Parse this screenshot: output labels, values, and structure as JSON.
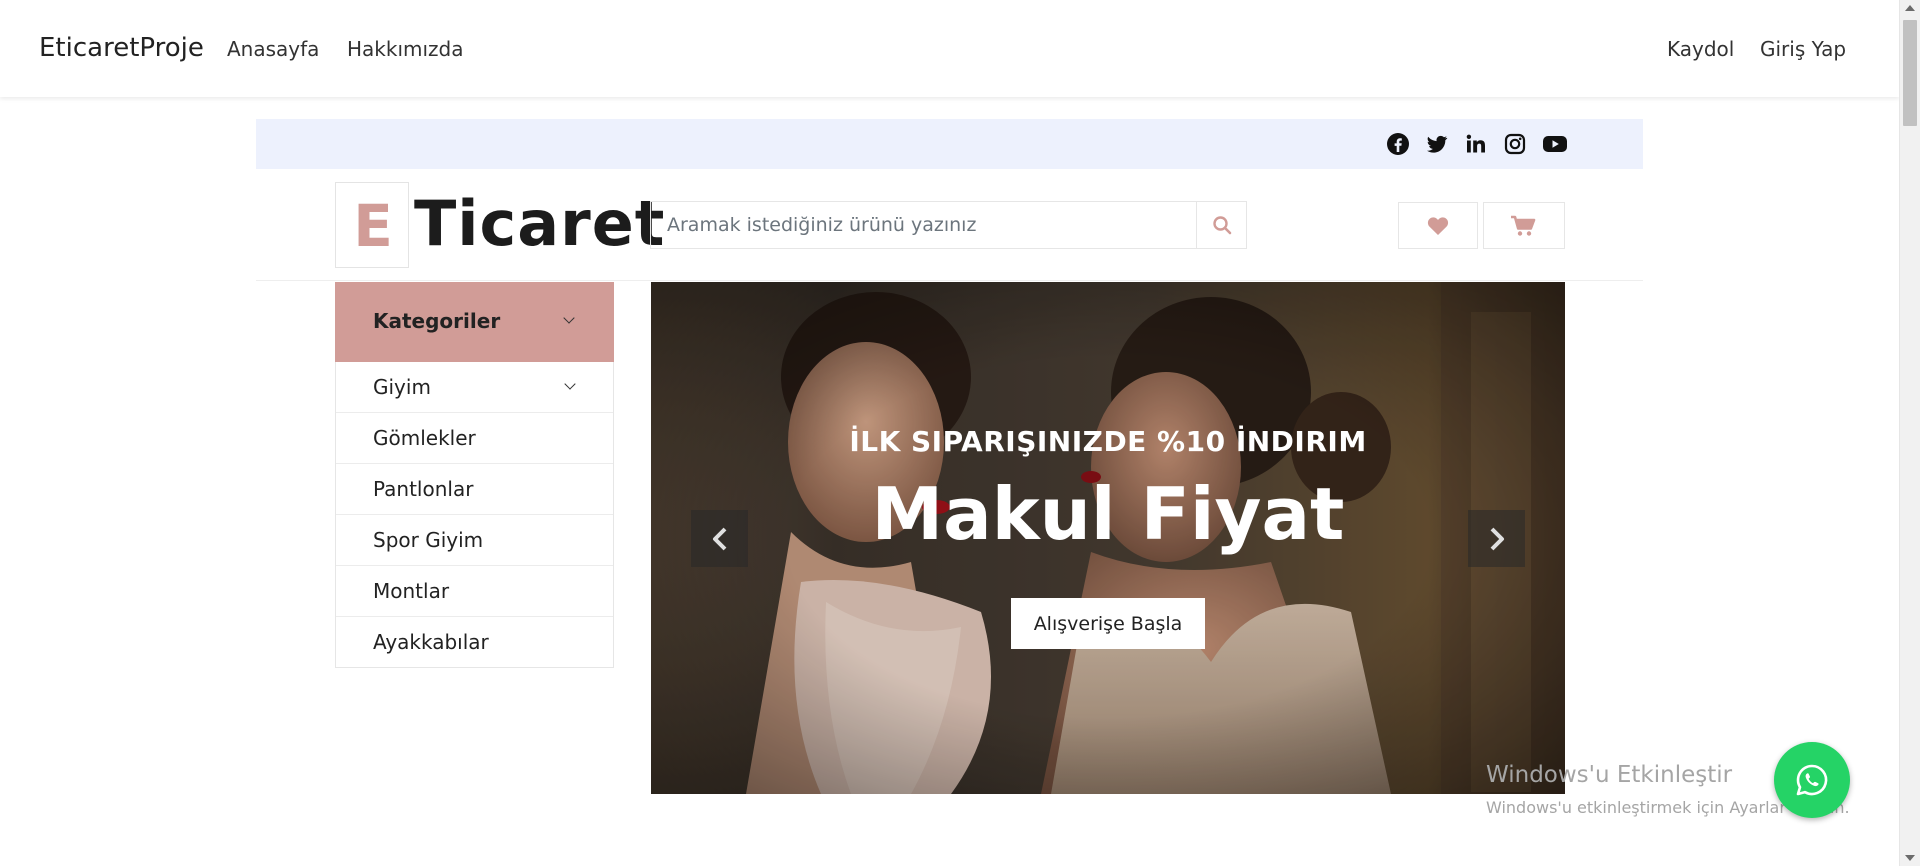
{
  "navbar": {
    "brand": "EticaretProje",
    "links": [
      "Anasayfa",
      "Hakkımızda"
    ],
    "right_links": [
      "Kaydol",
      "Giriş Yap"
    ]
  },
  "topbar": {
    "social_icons": [
      "facebook-icon",
      "twitter-icon",
      "linkedin-icon",
      "instagram-icon",
      "youtube-icon"
    ]
  },
  "header": {
    "logo_letter": "E",
    "logo_text": "Ticaret",
    "search_placeholder": "Aramak istediğiniz ürünü yazınız",
    "icons": [
      "search-icon",
      "heart-icon",
      "cart-icon"
    ]
  },
  "categories": {
    "title": "Kategoriler",
    "items": [
      "Giyim",
      "Gömlekler",
      "Pantlonlar",
      "Spor Giyim",
      "Montlar",
      "Ayakkabılar"
    ]
  },
  "carousel": {
    "subtitle": "İLK SIPARIŞINIZDE %10 İNDIRIM",
    "title": "Makul Fiyat",
    "button": "Alışverişe Başla"
  },
  "windows": {
    "line1": "Windows'u Etkinleştir",
    "line2": "Windows'u etkinleştirmek için Ayarlar'a gidin."
  },
  "colors": {
    "accent": "#d19c97",
    "topbar_bg": "#edf1fd",
    "whatsapp": "#25d366"
  }
}
